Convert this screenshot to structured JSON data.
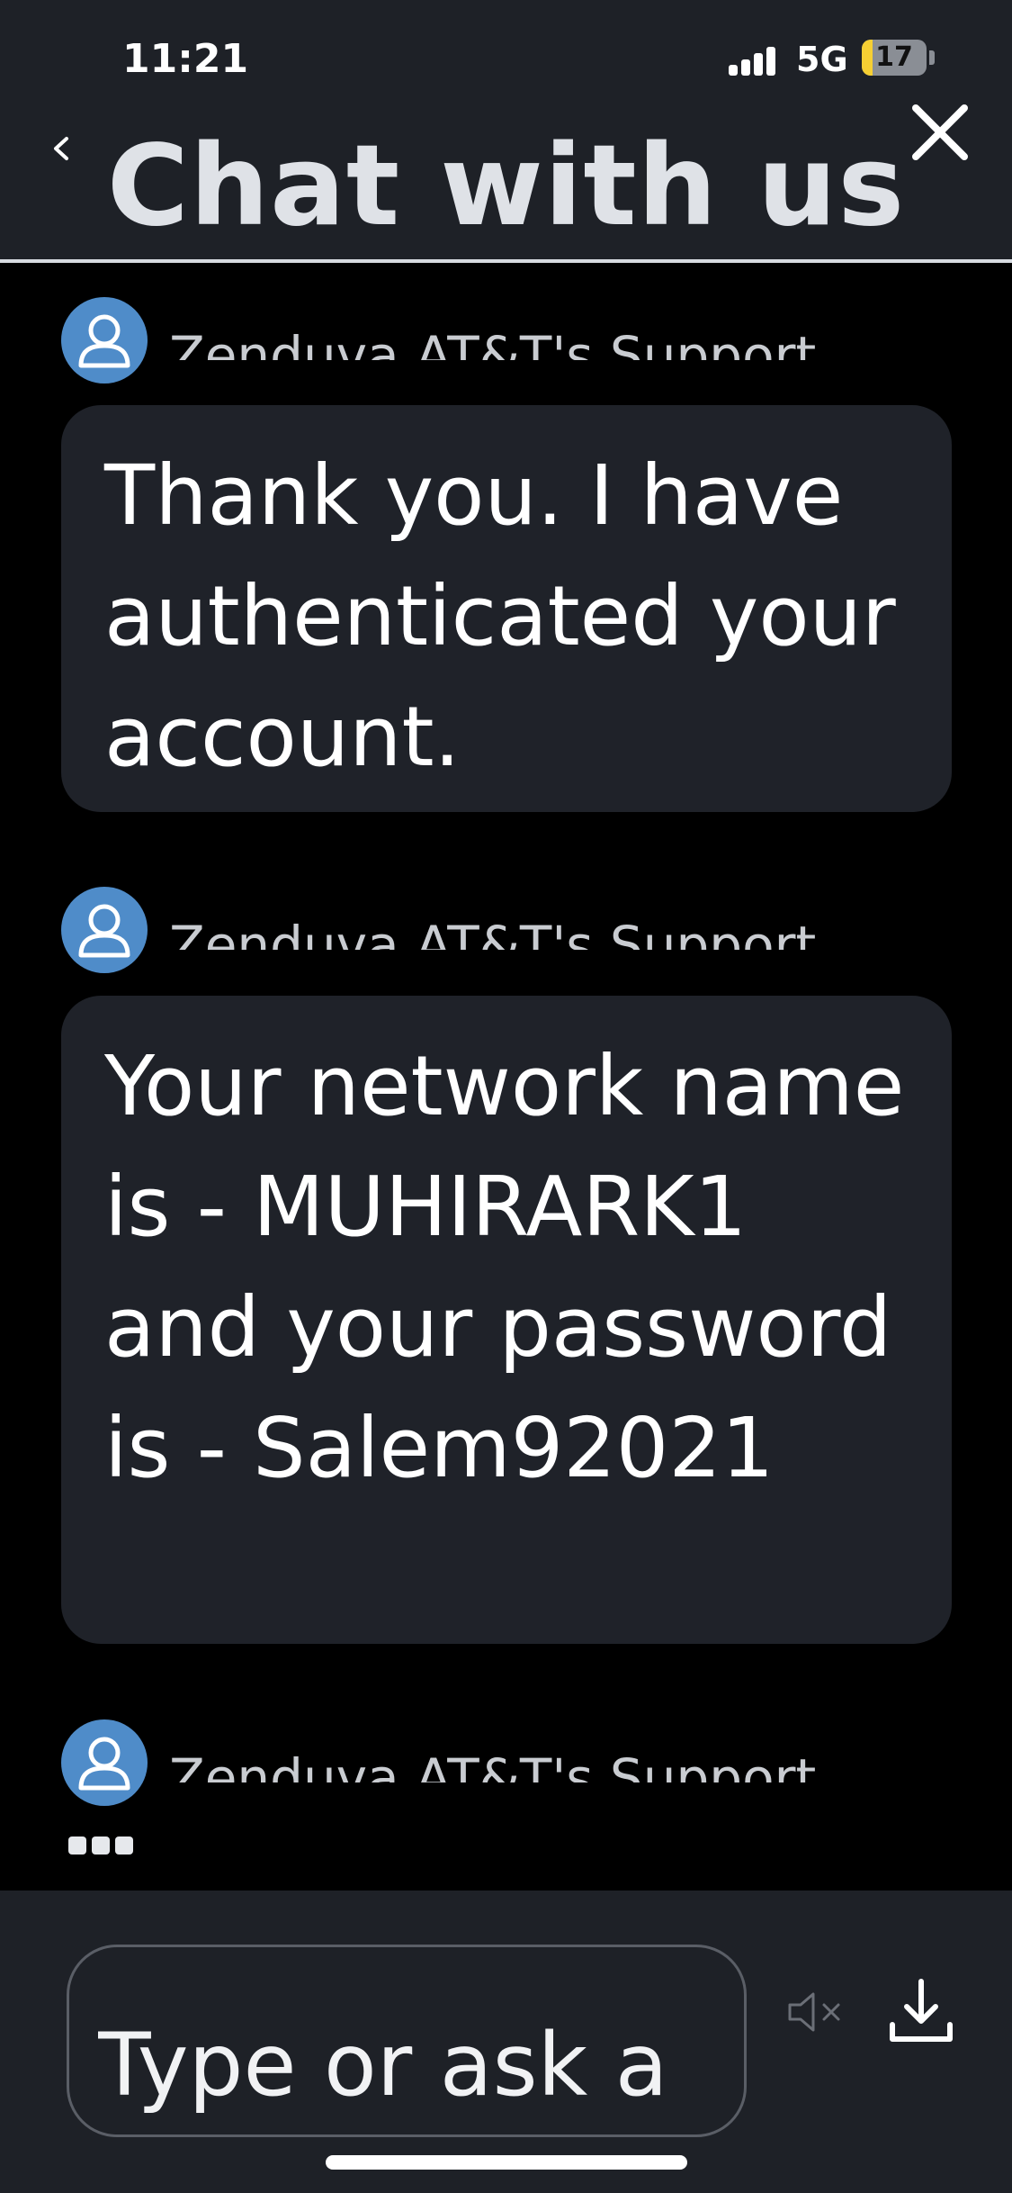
{
  "status_bar": {
    "time": "11:21",
    "network": "5G",
    "battery_percent": 17,
    "battery_label": "17"
  },
  "header": {
    "title": "Chat with us",
    "back_icon": "chevron-left-icon",
    "close_icon": "close-icon"
  },
  "messages": [
    {
      "sender": "Zenduva AT&T's Support",
      "text": "Thank you. I have authenticated your account."
    },
    {
      "sender": "Zenduva AT&T's Support",
      "text": "Your network name is - MUHIRARK1 and your password is - Salem92021"
    },
    {
      "sender": "Zenduva AT&T's Support",
      "typing": true
    }
  ],
  "composer": {
    "placeholder": "Type or ask a",
    "mute_icon": "speaker-muted-icon",
    "download_icon": "download-icon"
  },
  "colors": {
    "header_bg": "#1e2127",
    "bubble_bg": "#1f2229",
    "avatar_bg": "#4f8cc9",
    "background": "#000000"
  }
}
